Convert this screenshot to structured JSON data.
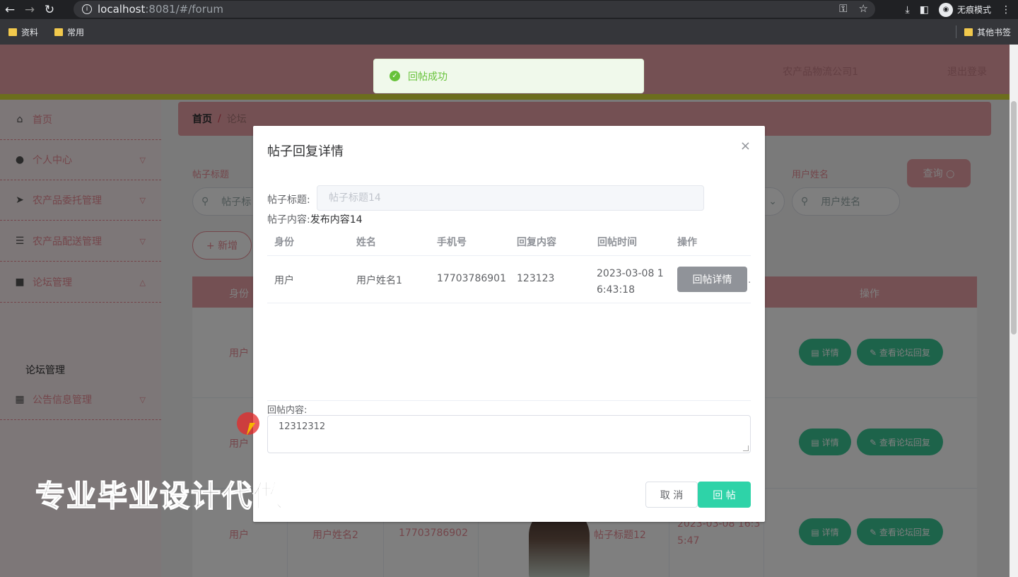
{
  "browser": {
    "url_host": "localhost",
    "url_path": ":8081/#/forum",
    "incognito_label": "无痕模式",
    "bookmarks": [
      "资料",
      "常用"
    ],
    "other_bookmarks": "其他书签"
  },
  "header": {
    "user_text": "农产品物流公司1",
    "logout": "退出登录"
  },
  "sidebar": {
    "items": [
      {
        "label": "首页",
        "icon": "home-icon",
        "glyph": "⌂"
      },
      {
        "label": "个人中心",
        "icon": "user-icon",
        "glyph": "●"
      },
      {
        "label": "农产品委托管理",
        "icon": "send-icon",
        "glyph": "➤"
      },
      {
        "label": "农产品配送管理",
        "icon": "sliders-icon",
        "glyph": "☰"
      },
      {
        "label": "论坛管理",
        "icon": "briefcase-icon",
        "glyph": "■"
      },
      {
        "label": "公告信息管理",
        "icon": "grid-icon",
        "glyph": "▦"
      }
    ],
    "sub_item": "论坛管理"
  },
  "breadcrumb": {
    "home": "首页",
    "sep": "/",
    "current": "论坛"
  },
  "filters": {
    "title_label": "帖子标题",
    "title_placeholder": "帖子标",
    "user_label": "用户姓名",
    "user_placeholder": "用户姓名",
    "query_button": "查询 ○",
    "add_button": "+ 新增"
  },
  "table": {
    "headers": {
      "identity": "身份",
      "ops": "操作"
    },
    "rows": [
      {
        "identity": "用户"
      },
      {
        "identity": "用户"
      },
      {
        "identity": "用户",
        "name": "用户姓名2",
        "phone": "17703786902",
        "title": "帖子标题12",
        "time_line1": "2023-03-08 16:3",
        "time_line2": "5:47"
      }
    ],
    "detail_button": "▤ 详情",
    "forum_reply_button": "✎ 查看论坛回复"
  },
  "dialog": {
    "title": "帖子回复详情",
    "close": "×",
    "post_title_label": "帖子标题:",
    "post_title_value": "帖子标题14",
    "post_content_label": "帖子内容:",
    "post_content_value": "发布内容14",
    "columns": [
      "身份",
      "姓名",
      "手机号",
      "回复内容",
      "回帖时间",
      "操作"
    ],
    "replies": [
      {
        "identity": "用户",
        "name": "用户姓名1",
        "phone": "17703786901",
        "content": "123123",
        "time_line1": "2023-03-08 1",
        "time_line2": "6:43:18",
        "action": "回帖详情"
      }
    ],
    "reply_content_label": "回帖内容:",
    "reply_text": "12312312",
    "cancel_button": "取 消",
    "reply_button": "回 帖"
  },
  "toast": {
    "message": "回帖成功"
  },
  "watermark": "专业毕业设计代做"
}
